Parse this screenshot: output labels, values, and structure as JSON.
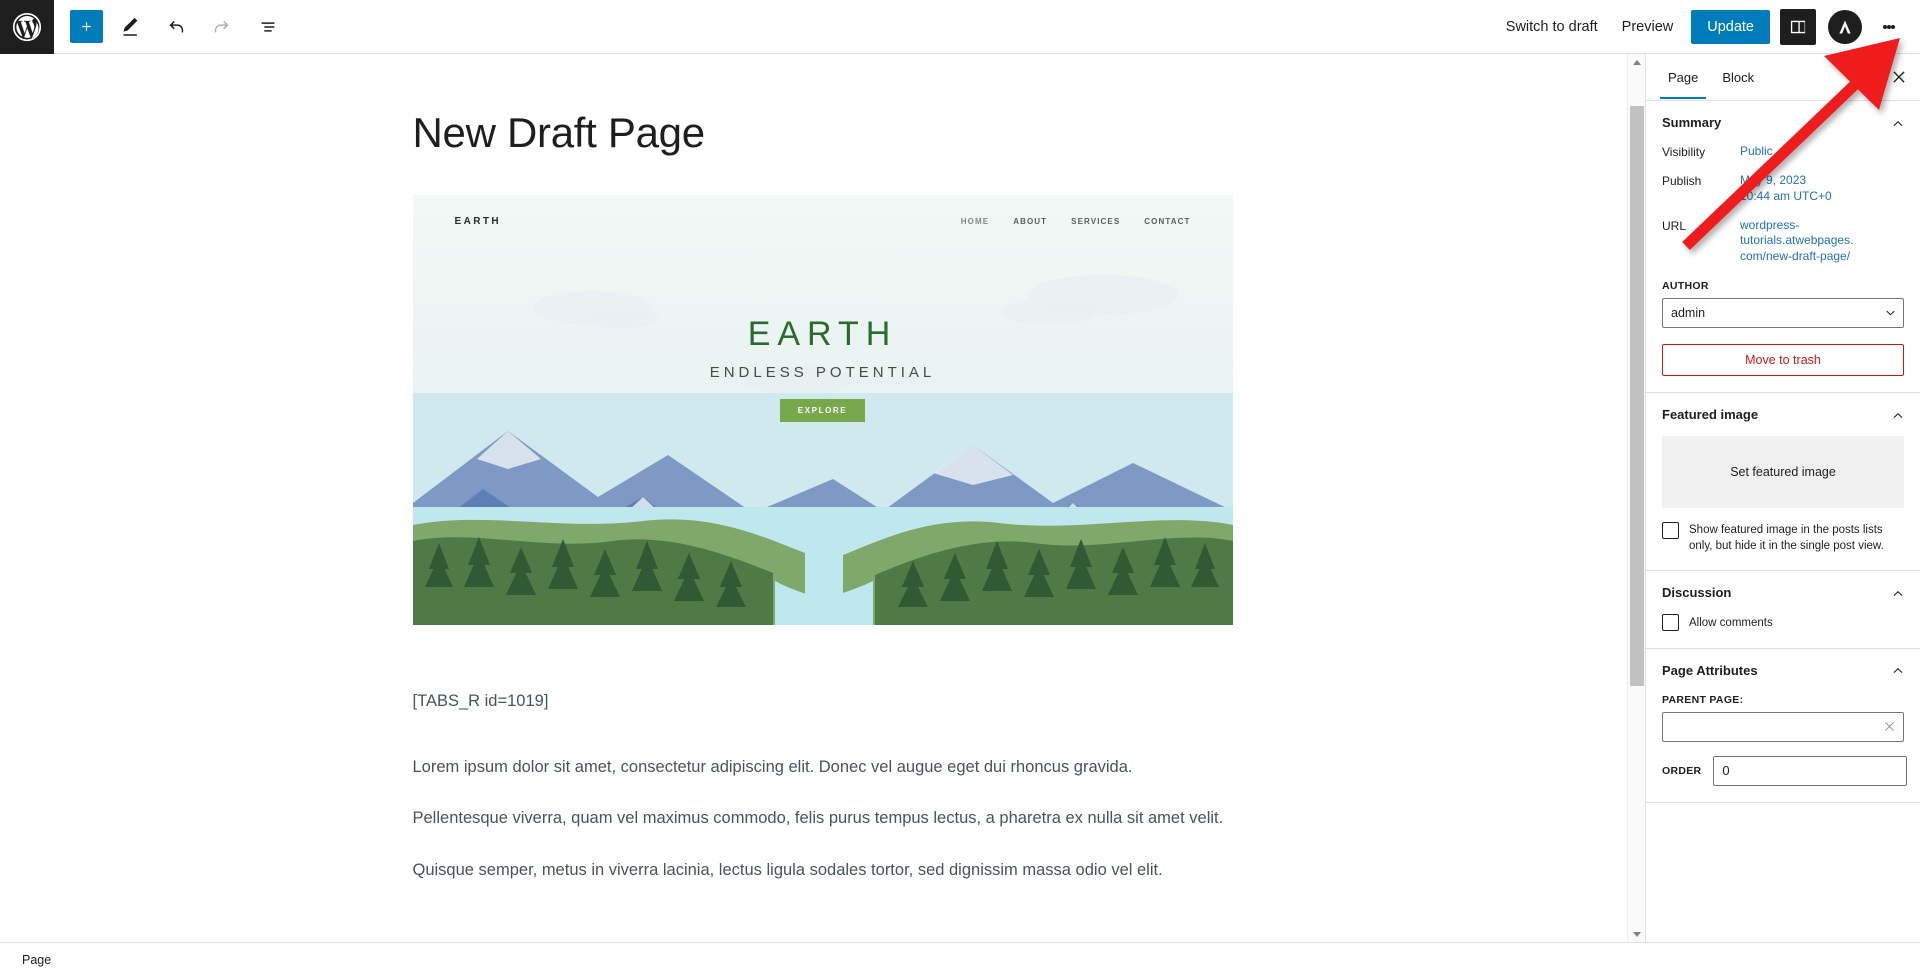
{
  "toolbar": {
    "logo_icon": "wordpress-logo-icon",
    "add_block_label": "+",
    "add_block_icon": "plus-icon",
    "tools_icon": "pencil-icon",
    "undo_icon": "undo-arrow-icon",
    "redo_icon": "redo-arrow-icon",
    "list_view_icon": "document-overview-icon",
    "switch_to_draft": "Switch to draft",
    "preview": "Preview",
    "update": "Update",
    "settings_icon": "settings-sidebar-icon",
    "avatar_icon": "astra-logo-icon",
    "options_icon": "three-dot-menu-icon"
  },
  "editor": {
    "title": "New Draft Page",
    "hero": {
      "brand": "EARTH",
      "nav": [
        "HOME",
        "ABOUT",
        "SERVICES",
        "CONTACT"
      ],
      "headline": "EARTH",
      "subheadline": "ENDLESS POTENTIAL",
      "cta": "EXPLORE"
    },
    "paragraphs": [
      "[TABS_R id=1019]",
      "Lorem ipsum dolor sit amet, consectetur adipiscing elit. Donec vel augue eget dui rhoncus gravida.",
      "Pellentesque viverra, quam vel maximus commodo, felis purus tempus lectus, a pharetra ex nulla sit amet velit.",
      "Quisque semper, metus in viverra lacinia, lectus ligula sodales tortor, sed dignissim massa odio vel elit."
    ]
  },
  "sidebar": {
    "tabs": [
      {
        "label": "Page",
        "active": true
      },
      {
        "label": "Block",
        "active": false
      }
    ],
    "close_icon": "close-icon",
    "summary": {
      "title": "Summary",
      "collapse_icon": "chevron-up-icon",
      "visibility_label": "Visibility",
      "visibility_value": "Public",
      "publish_label": "Publish",
      "publish_date": "May 9, 2023",
      "publish_time": "10:44 am UTC+0",
      "url_label": "URL",
      "url_value": "wordpress-tutorials.atwebpages.com/new-draft-page/",
      "author_label": "AUTHOR",
      "author_value": "admin",
      "author_options": [
        "admin"
      ],
      "trash_label": "Move to trash"
    },
    "featured_image": {
      "title": "Featured image",
      "collapse_icon": "chevron-up-icon",
      "set_label": "Set featured image",
      "checkbox_label": "Show featured image in the posts lists only, but hide it in the single post view.",
      "checked": false
    },
    "discussion": {
      "title": "Discussion",
      "collapse_icon": "chevron-up-icon",
      "allow_comments_label": "Allow comments",
      "checked": false
    },
    "page_attributes": {
      "title": "Page Attributes",
      "collapse_icon": "chevron-up-icon",
      "parent_label": "PARENT PAGE:",
      "parent_value": "",
      "parent_clear_icon": "clear-x-icon",
      "order_label": "ORDER",
      "order_value": "0"
    }
  },
  "statusbar": {
    "label": "Page"
  },
  "colors": {
    "accent": "#007cba",
    "danger": "#cc1818",
    "annotation": "#ee1c1c",
    "dark": "#1e1e1e"
  }
}
